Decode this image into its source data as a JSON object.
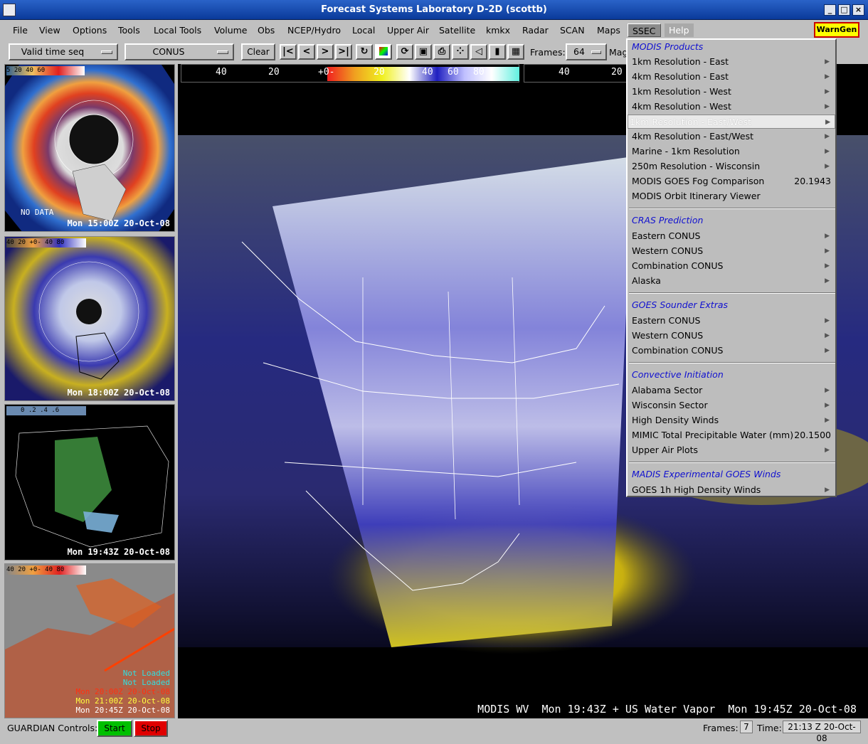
{
  "window": {
    "title": "Forecast Systems Laboratory D-2D (scottb)"
  },
  "menubar": {
    "items": [
      "File",
      "View",
      "Options",
      "Tools",
      "Local Tools",
      "Volume",
      "Obs",
      "NCEP/Hydro",
      "Local",
      "Upper Air",
      "Satellite",
      "kmkx",
      "Radar",
      "SCAN",
      "Maps",
      "SSEC",
      "Help"
    ],
    "warngen": "WarnGen"
  },
  "toolbar": {
    "time_mode": "Valid time seq",
    "scale": "CONUS",
    "clear": "Clear",
    "frames_label": "Frames:",
    "frames_value": "64",
    "mag_label": "Mag"
  },
  "panes": {
    "p1": {
      "colorbar": "5 20 40 60",
      "overlay": "NO DATA",
      "time": "Mon 15:00Z 20-Oct-08"
    },
    "p2": {
      "colorbar": "40 20 +0- 40 80",
      "time": "Mon 18:00Z 20-Oct-08"
    },
    "p3": {
      "colorbar": "0 .2 .4 .6",
      "time": "Mon 19:43Z 20-Oct-08"
    },
    "p4": {
      "colorbar": "40 20 +0- 40 80",
      "status": [
        "Not Loaded",
        "Not Loaded",
        "Mon 20:00Z 20-Oct-08",
        "Mon 21:00Z 20-Oct-08",
        "Mon 20:45Z 20-Oct-08"
      ]
    }
  },
  "main": {
    "colorbar_labels": [
      "40",
      "20",
      "+0-",
      "20",
      "40",
      "60",
      "80"
    ],
    "colorbar2_labels": [
      "40",
      "20"
    ],
    "caption": "MODIS WV  Mon 19:43Z + US Water Vapor  Mon 19:45Z 20-Oct-08"
  },
  "dropdown": {
    "sections": [
      {
        "header": "MODIS Products",
        "items": [
          {
            "label": "1km Resolution - East",
            "submenu": true
          },
          {
            "label": "4km Resolution - East",
            "submenu": true
          },
          {
            "label": "1km Resolution - West",
            "submenu": true
          },
          {
            "label": "4km Resolution - West",
            "submenu": true
          },
          {
            "label": "1km Resolution - East/West",
            "submenu": true,
            "selected": true
          },
          {
            "label": "4km Resolution - East/West",
            "submenu": true
          },
          {
            "label": "Marine - 1km Resolution",
            "submenu": true
          },
          {
            "label": "250m Resolution - Wisconsin",
            "submenu": true
          },
          {
            "label": "MODIS GOES Fog Comparison",
            "value": "20.1943"
          },
          {
            "label": "MODIS Orbit Itinerary Viewer"
          }
        ]
      },
      {
        "header": "CRAS Prediction",
        "items": [
          {
            "label": "Eastern CONUS",
            "submenu": true
          },
          {
            "label": "Western CONUS",
            "submenu": true
          },
          {
            "label": "Combination CONUS",
            "submenu": true
          },
          {
            "label": "Alaska",
            "submenu": true
          }
        ]
      },
      {
        "header": "GOES Sounder Extras",
        "items": [
          {
            "label": "Eastern CONUS",
            "submenu": true
          },
          {
            "label": "Western CONUS",
            "submenu": true
          },
          {
            "label": "Combination CONUS",
            "submenu": true
          }
        ]
      },
      {
        "header": "Convective Initiation",
        "items": [
          {
            "label": "Alabama Sector",
            "submenu": true
          },
          {
            "label": "Wisconsin Sector",
            "submenu": true
          },
          {
            "label": "High Density Winds",
            "submenu": true
          },
          {
            "label": "MIMIC Total Precipitable Water (mm)",
            "value": "20.1500"
          },
          {
            "label": "Upper Air Plots",
            "submenu": true
          }
        ]
      },
      {
        "header": "MADIS Experimental GOES Winds",
        "items": [
          {
            "label": "GOES 1h High Density Winds",
            "submenu": true
          }
        ]
      }
    ]
  },
  "statusbar": {
    "guardian_label": "GUARDIAN Controls:",
    "start": "Start",
    "stop": "Stop",
    "frames_label": "Frames:",
    "frames_value": "7",
    "time_label": "Time:",
    "time_value": "21:13 Z 20-Oct-08"
  },
  "colors": {
    "titlebar": "#1a4fb5",
    "start": "#00c000",
    "stop": "#e00000",
    "menu_header": "#1010d0"
  }
}
